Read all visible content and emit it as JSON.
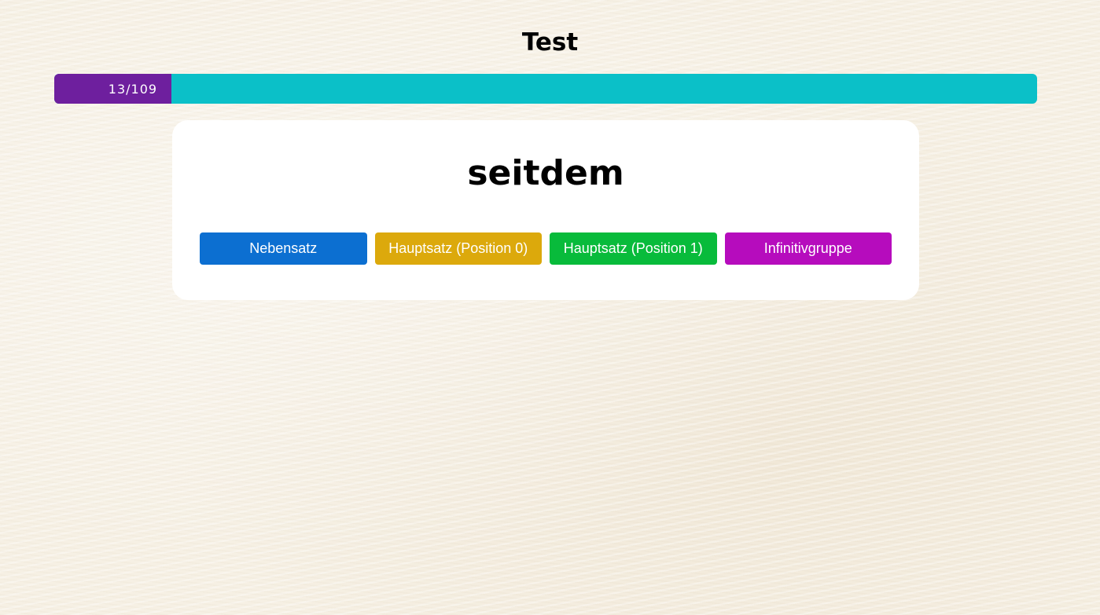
{
  "header": {
    "title": "Test"
  },
  "progress": {
    "current": 13,
    "total": 109,
    "label": "13/109",
    "fill_color": "#6e1f9e",
    "track_color": "#0bc0c8"
  },
  "question": {
    "word": "seitdem"
  },
  "answers": [
    {
      "label": "Nebensatz",
      "color": "#0c6fd1"
    },
    {
      "label": "Hauptsatz (Position 0)",
      "color": "#dca90c"
    },
    {
      "label": "Hauptsatz (Position 1)",
      "color": "#08bb3b"
    },
    {
      "label": "Infinitivgruppe",
      "color": "#b60cbd"
    }
  ]
}
